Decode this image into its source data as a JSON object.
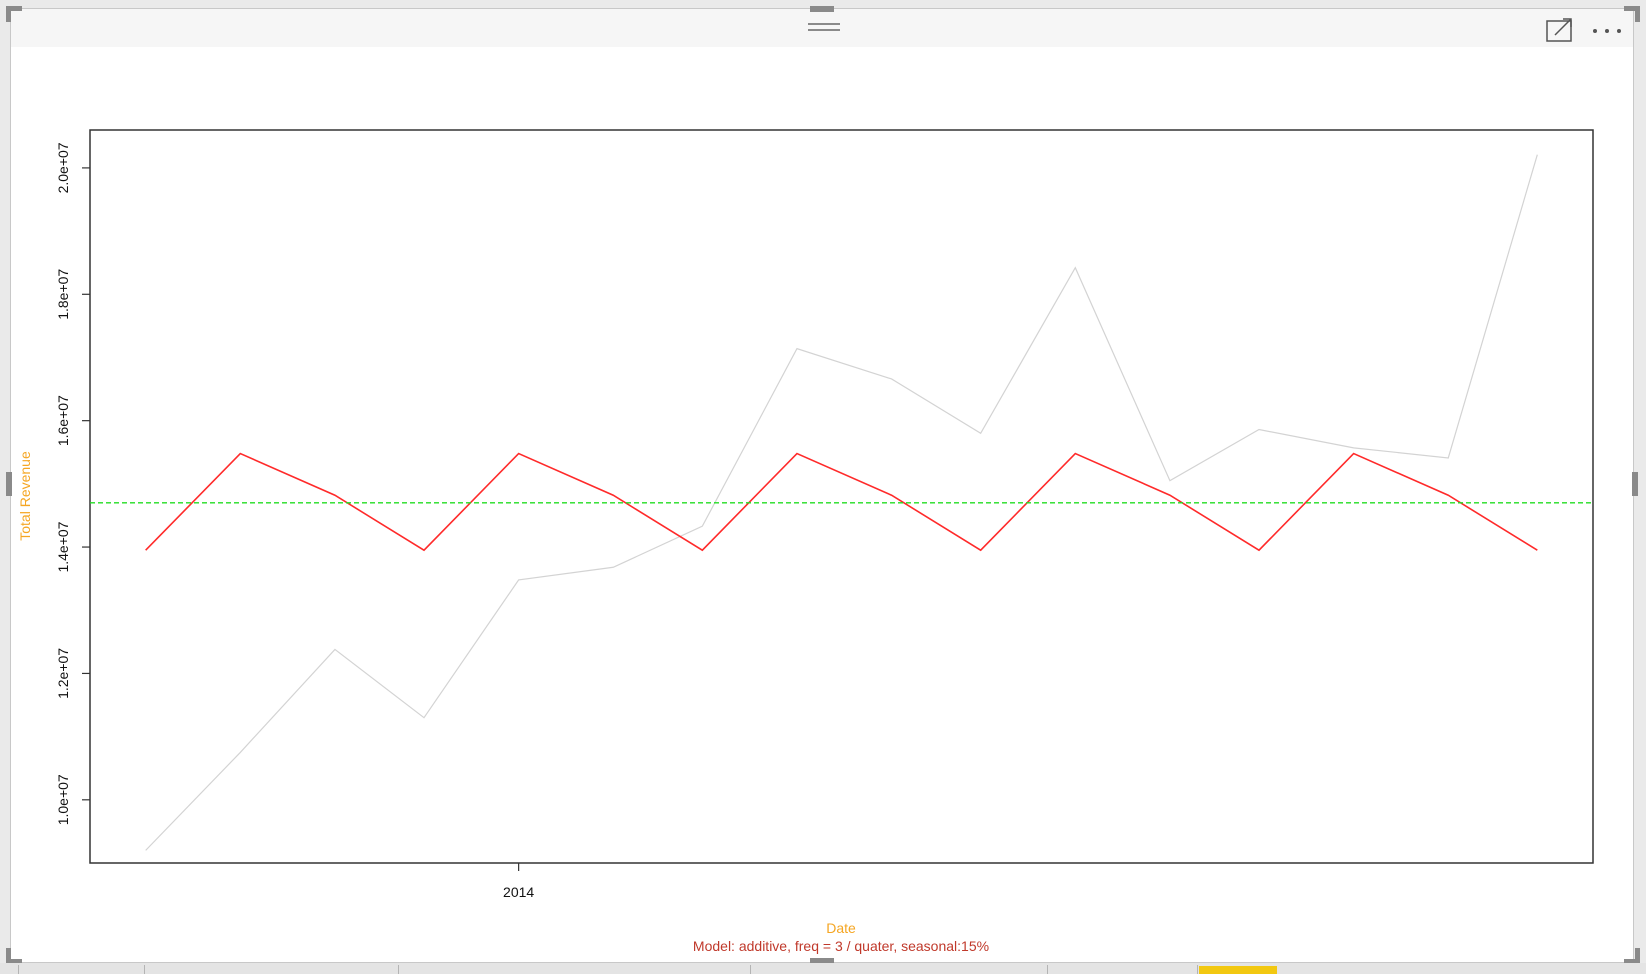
{
  "colors": {
    "axis_title": "#f5a623",
    "subtitle": "#c0392b",
    "observed_series": "#d3d3d3",
    "seasonal_series": "#ff2a2a",
    "mean_line": "#22dd22",
    "plot_border": "#333333",
    "tab_active": "#f2c811"
  },
  "visual_header": {
    "drag_icon": "drag-handle-icon",
    "focus_icon": "focus-mode-icon",
    "more_icon": "more-options-icon"
  },
  "chart_data": {
    "type": "line",
    "xlabel": "Date",
    "ylabel": "Total Revenue",
    "subtitle": "Model: additive, freq = 3 / quater, seasonal:15%",
    "x": [
      2013.33,
      2013.5,
      2013.67,
      2013.83,
      2014.0,
      2014.17,
      2014.33,
      2014.5,
      2014.67,
      2014.83,
      2015.0,
      2015.17,
      2015.33,
      2015.5,
      2015.67,
      2015.83
    ],
    "x_ticks": [
      {
        "value": 2014.0,
        "label": "2014"
      }
    ],
    "xlim": [
      2013.23,
      2015.93
    ],
    "ylim": [
      9000000,
      20600000
    ],
    "y_ticks": [
      {
        "value": 10000000,
        "label": "1.0e+07"
      },
      {
        "value": 12000000,
        "label": "1.2e+07"
      },
      {
        "value": 14000000,
        "label": "1.4e+07"
      },
      {
        "value": 16000000,
        "label": "1.6e+07"
      },
      {
        "value": 18000000,
        "label": "1.8e+07"
      },
      {
        "value": 20000000,
        "label": "2.0e+07"
      }
    ],
    "series": [
      {
        "key": "observed",
        "values": [
          9200000,
          10750000,
          12380000,
          11300000,
          13480000,
          13680000,
          14330000,
          17140000,
          16660000,
          15800000,
          18420000,
          15050000,
          15860000,
          15570000,
          15410000,
          20210000
        ]
      },
      {
        "key": "seasonal",
        "values": [
          13950000,
          15480000,
          14820000,
          13950000,
          15480000,
          14820000,
          13950000,
          15480000,
          14820000,
          13950000,
          15480000,
          14820000,
          13950000,
          15480000,
          14820000,
          13950000
        ]
      }
    ],
    "reference_line": {
      "value": 14700000,
      "style": "dashed"
    },
    "grid": false,
    "legend": "none"
  }
}
